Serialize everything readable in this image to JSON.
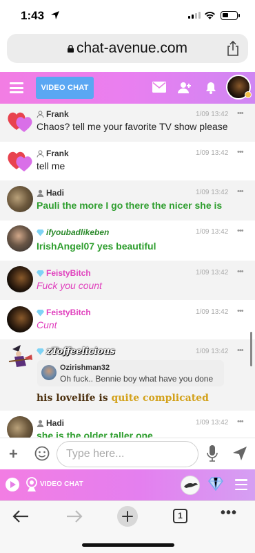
{
  "status_bar": {
    "time": "1:43"
  },
  "browser": {
    "url": "chat-avenue.com",
    "tab_count": "1"
  },
  "header": {
    "video_chat_label": "VIDEO CHAT"
  },
  "messages": [
    {
      "user": "Frank",
      "time": "1/09 13:42",
      "text": "Chaos? tell me your favorite TV show please"
    },
    {
      "user": "Frank",
      "time": "1/09 13:42",
      "text": "tell me"
    },
    {
      "user": "Hadi",
      "time": "1/09 13:42",
      "text": "Pauli the more I go there the nicer she is"
    },
    {
      "user": "ifyoubadlikeben",
      "time": "1/09 13:42",
      "text": "IrishAngel07 yes beautiful"
    },
    {
      "user": "FeistyBitch",
      "time": "1/09 13:42",
      "text": "Fuck you count"
    },
    {
      "user": "FeistyBitch",
      "time": "1/09 13:42",
      "text": "Cunt"
    },
    {
      "user": "zToffeelicious",
      "time": "1/09 13:42",
      "quote": {
        "user": "Ozirishman32",
        "text": "Oh fuck.. Bennie boy what have you done"
      },
      "text_part1": "his lovelife is ",
      "text_part2": "quite complicated"
    },
    {
      "user": "Hadi",
      "time": "1/09 13:42",
      "text": "she is the older taller one"
    }
  ],
  "composer": {
    "placeholder": "Type here..."
  },
  "bottom_bar": {
    "video_chat_label": "VIDEO CHAT"
  },
  "colors": {
    "brand_pink": "#f27de3",
    "button_blue": "#5aa7f3",
    "name_pink": "#e03fbd",
    "text_green": "#2e9e2e"
  }
}
